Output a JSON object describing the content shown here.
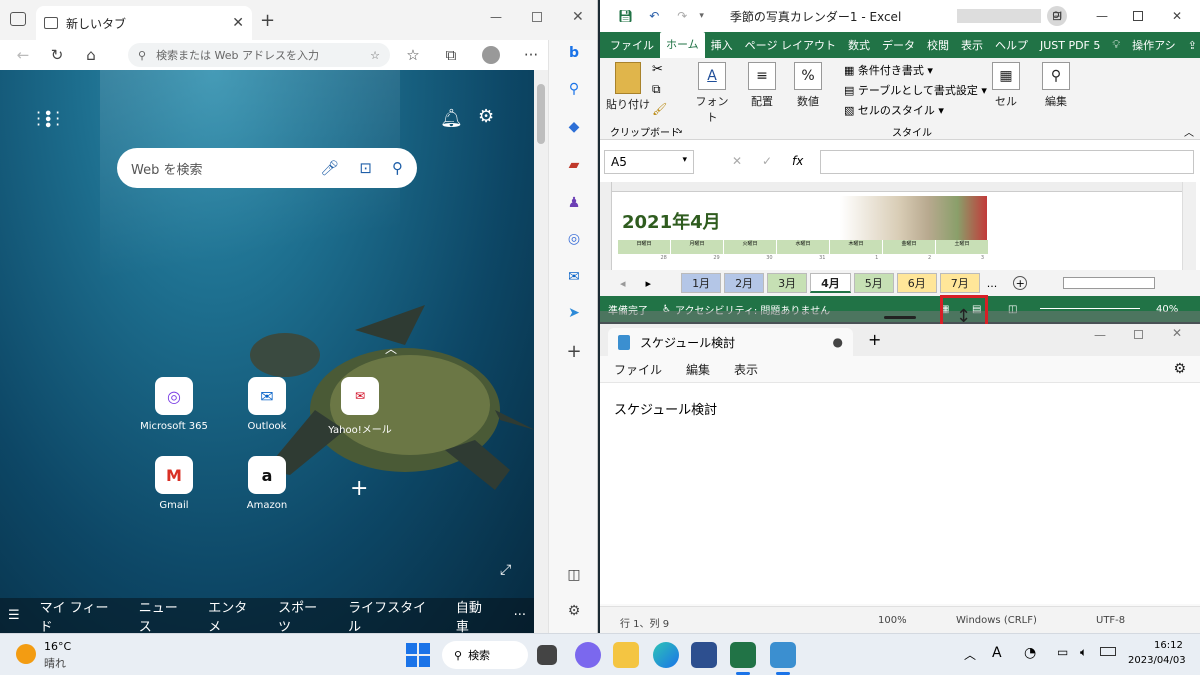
{
  "edge": {
    "tab_title": "新しいタブ",
    "address_placeholder": "検索または Web アドレスを入力",
    "search_placeholder": "Web を検索",
    "tiles": [
      {
        "label": "Microsoft 365",
        "icon": "microsoft365-icon"
      },
      {
        "label": "Outlook",
        "icon": "outlook-icon"
      },
      {
        "label": "Yahoo!メール",
        "icon": "yahoo-mail-icon"
      },
      {
        "label": "Gmail",
        "icon": "gmail-icon"
      },
      {
        "label": "Amazon",
        "icon": "amazon-icon"
      }
    ],
    "feed_tabs": [
      "マイ フィード",
      "ニュース",
      "エンタメ",
      "スポーツ",
      "ライフスタイル",
      "自動車"
    ],
    "more": "···",
    "add_tile": "+"
  },
  "excel": {
    "title": "季節の写真カレンダー1 - Excel",
    "user_initials": "OJ",
    "menu": [
      "ファイル",
      "ホーム",
      "挿入",
      "ページ レイアウト",
      "数式",
      "データ",
      "校閲",
      "表示",
      "ヘルプ",
      "JUST PDF 5",
      "操作アシ"
    ],
    "ribbon": {
      "paste": "貼り付け",
      "clipboard_group": "クリップボード",
      "font": "フォント",
      "alignment": "配置",
      "number": "数値",
      "conditional": "条件付き書式",
      "table_format": "テーブルとして書式設定",
      "cell_style": "セルのスタイル",
      "style_group": "スタイル",
      "cells": "セル",
      "editing": "編集"
    },
    "name_box": "A5",
    "fx": "fx",
    "sheet_title": "2021年4月",
    "weekdays": [
      "日曜日",
      "月曜日",
      "火曜日",
      "水曜日",
      "木曜日",
      "金曜日",
      "土曜日"
    ],
    "dates": [
      "28",
      "29",
      "30",
      "31",
      "1",
      "2",
      "3"
    ],
    "sheet_tabs": [
      "1月",
      "2月",
      "3月",
      "4月",
      "5月",
      "6月",
      "7月"
    ],
    "sheet_tab_more": "...",
    "status_ready": "準備完了",
    "status_access": "アクセシビリティ: 問題ありません",
    "zoom": "40%"
  },
  "notepad": {
    "tab_title": "スケジュール検討",
    "menu": [
      "ファイル",
      "編集",
      "表示"
    ],
    "content": "スケジュール検討",
    "status": {
      "position": "行 1、列 9",
      "zoom": "100%",
      "eol": "Windows (CRLF)",
      "encoding": "UTF-8"
    }
  },
  "taskbar": {
    "temp": "16°C",
    "weather": "晴れ",
    "search": "検索",
    "time": "16:12",
    "date": "2023/04/03"
  }
}
